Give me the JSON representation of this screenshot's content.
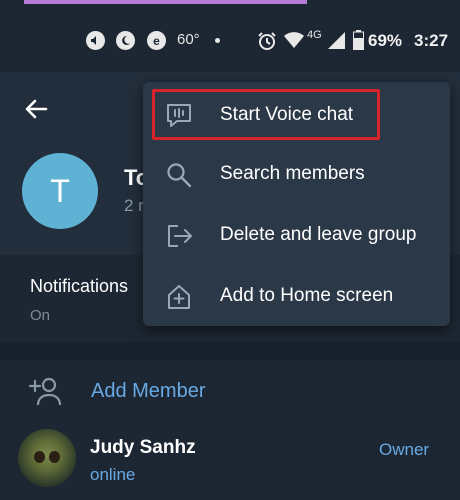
{
  "status_bar": {
    "temperature": "60°",
    "network_type": "4G",
    "battery_percent": "69%",
    "time": "3:27",
    "icons": [
      "volume-icon",
      "moon-icon",
      "e-app-icon",
      "dot-icon",
      "alarm-icon",
      "wifi-icon",
      "signal-icon",
      "battery-icon"
    ]
  },
  "header": {
    "avatar_letter": "T",
    "group_name_visible": "To",
    "subtitle_visible": "2 r"
  },
  "menu": {
    "items": [
      {
        "label": "Start Voice chat",
        "icon": "voice-chat-icon"
      },
      {
        "label": "Search members",
        "icon": "search-icon"
      },
      {
        "label": "Delete and leave group",
        "icon": "leave-group-icon"
      },
      {
        "label": "Add to Home screen",
        "icon": "add-home-icon"
      }
    ]
  },
  "notifications": {
    "label": "Notifications",
    "value": "On"
  },
  "members": {
    "add_label": "Add Member",
    "list": [
      {
        "name": "Judy Sanhz",
        "status": "online",
        "role": "Owner"
      }
    ]
  },
  "colors": {
    "accent": "#69a9e3",
    "highlight": "#d9232b",
    "avatar": "#5fb2d4",
    "background": "#1d2733",
    "menu_bg": "#2b3847"
  }
}
